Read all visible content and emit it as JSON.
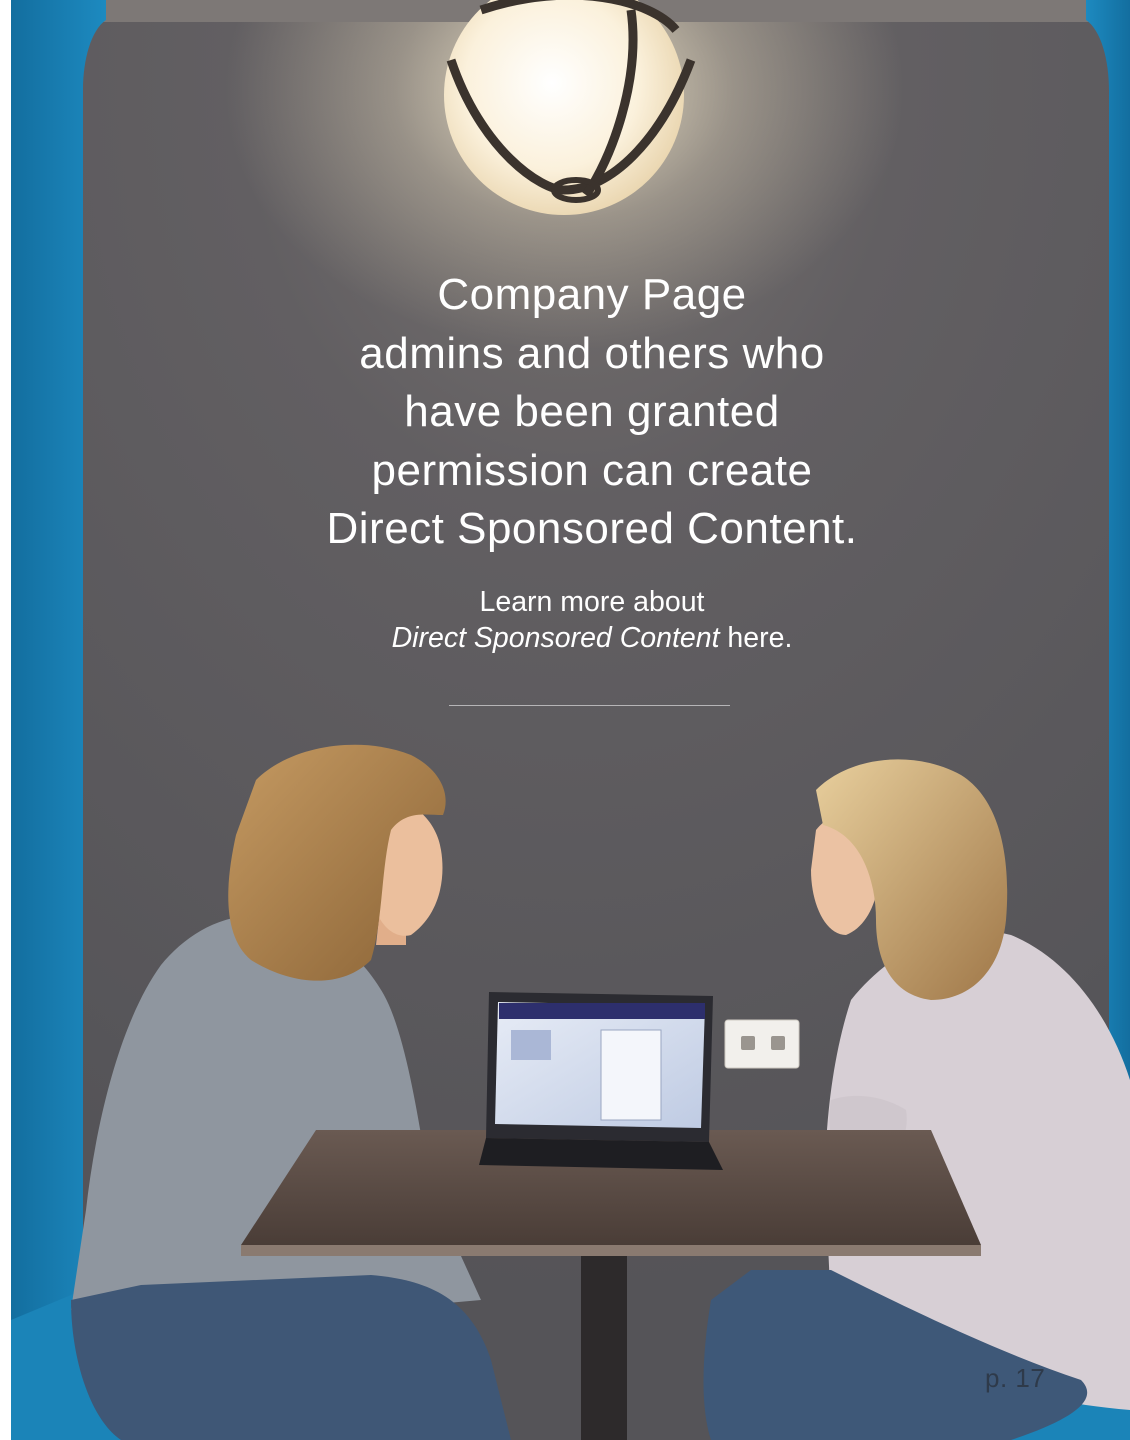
{
  "headline": {
    "lines": [
      "Company Page",
      "admins and others who",
      "have been granted",
      "permission can create",
      "Direct Sponsored Content."
    ]
  },
  "learn_more": {
    "line1": "Learn more about",
    "link_text": "Direct Sponsored Content",
    "suffix": " here."
  },
  "footer": {
    "page_number": "p. 17"
  },
  "colors": {
    "wall": "#5d5b5e",
    "booth": "#1b84b8",
    "headline_text": "#ffffff",
    "page_number_text": "#2e3a4a"
  },
  "photo": {
    "subject": "two-women-at-laptop-in-booth",
    "icon": "photograph"
  }
}
